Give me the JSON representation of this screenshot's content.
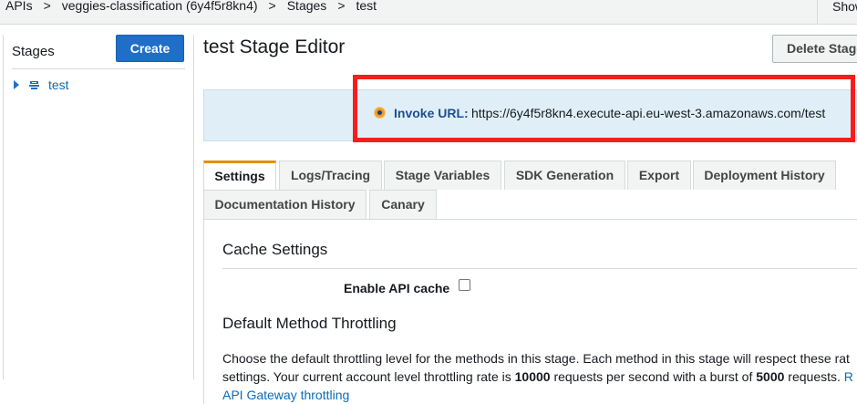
{
  "breadcrumb": {
    "items": [
      "APIs",
      "veggies-classification (6y4f5r8kn4)",
      "Stages",
      "test"
    ],
    "separator": ">"
  },
  "topbar": {
    "show_label": "Show"
  },
  "sidebar": {
    "title": "Stages",
    "create_label": "Create",
    "stages": [
      {
        "label": "test"
      }
    ]
  },
  "main": {
    "title": "test Stage Editor",
    "delete_label": "Delete Stage",
    "invoke": {
      "label": "Invoke URL:",
      "url": "https://6y4f5r8kn4.execute-api.eu-west-3.amazonaws.com/test"
    },
    "tabs": [
      {
        "label": "Settings",
        "active": true
      },
      {
        "label": "Logs/Tracing"
      },
      {
        "label": "Stage Variables"
      },
      {
        "label": "SDK Generation"
      },
      {
        "label": "Export"
      },
      {
        "label": "Deployment History"
      },
      {
        "label": "Documentation History"
      },
      {
        "label": "Canary"
      }
    ],
    "cache": {
      "heading": "Cache Settings",
      "enable_label": "Enable API cache",
      "enabled": false
    },
    "throttling": {
      "heading": "Default Method Throttling",
      "line1": "Choose the default throttling level for the methods in this stage. Each method in this stage will respect these rat",
      "line2_prefix": "settings. Your current account level throttling rate is ",
      "rate": "10000",
      "line2_middle": " requests per second with a burst of ",
      "burst": "5000",
      "line2_suffix": " requests. ",
      "line2_link": "R",
      "link_text": "API Gateway throttling"
    }
  },
  "colors": {
    "accent_tab": "#e78e0d",
    "primary_button": "#1f6ec8",
    "highlight_box": "#f51d1d",
    "info_bg": "#e0eff7",
    "link": "#0b6cb8"
  }
}
